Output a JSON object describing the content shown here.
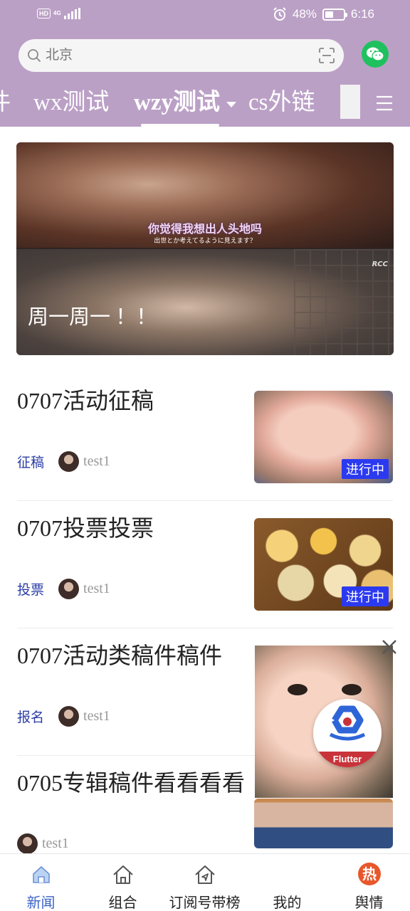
{
  "status_bar": {
    "network": "4G",
    "battery": "48%",
    "battery_fraction": 0.48,
    "time": "6:16"
  },
  "search": {
    "placeholder": "北京"
  },
  "tabs": [
    {
      "label": "件"
    },
    {
      "label": "wx测试"
    },
    {
      "label": "wzy测试",
      "active": true
    },
    {
      "label": "cs外链"
    }
  ],
  "banner": {
    "subtitle_zh": "你觉得我想出人头地吗",
    "subtitle_jp": "出世とか考えてるように見えます？",
    "watermark": "RCC",
    "title": "周一周一 ！！"
  },
  "articles": [
    {
      "title": "0707活动征稿",
      "tag": "征稿",
      "author": "test1",
      "status": "进行中"
    },
    {
      "title": "0707投票投票",
      "tag": "投票",
      "author": "test1",
      "status": "进行中"
    },
    {
      "title": "0707活动类稿件稿件",
      "tag": "报名",
      "author": "test1"
    },
    {
      "title": "0705专辑稿件看看看看",
      "author": "test1"
    }
  ],
  "flutter_badge": {
    "label": "Flutter"
  },
  "bottom_nav": [
    {
      "label": "新闻",
      "icon": "home-icon",
      "active": true
    },
    {
      "label": "组合",
      "icon": "home-outline-icon"
    },
    {
      "label": "订阅号带榜单",
      "icon": "send-house-icon"
    },
    {
      "label": "我的",
      "icon": "none"
    },
    {
      "label": "舆情",
      "icon": "hot-icon",
      "glyph": "热"
    }
  ],
  "colors": {
    "header": "#bba0c6",
    "tag": "#2b3ea6",
    "badge": "#2b3af0",
    "nav_active": "#3c62c8",
    "wechat": "#1fc15e"
  }
}
